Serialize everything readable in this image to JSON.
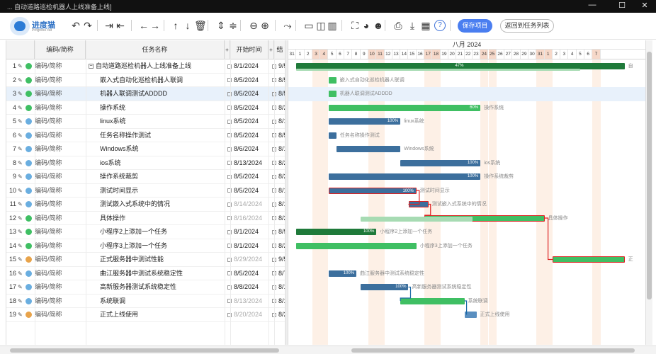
{
  "window": {
    "title": "... 自动道路巡检机器人上线准备上线]",
    "minimize": "—",
    "maximize": "☐",
    "close": "✕"
  },
  "logo": {
    "name": "进度猫",
    "sub": "Progress cat"
  },
  "toolbar": {
    "icons": [
      "undo-icon",
      "redo-icon",
      "indent-icon",
      "outdent-icon",
      "move-left-icon",
      "move-right-icon",
      "move-up-icon",
      "move-down-icon",
      "delete-icon",
      "expand-icon",
      "collapse-icon",
      "zoom-out-icon",
      "zoom-in-icon",
      "link-icon",
      "layout-1-icon",
      "layout-2-icon",
      "layout-3-icon",
      "fullscreen-icon",
      "palette-icon",
      "users-icon",
      "print-icon",
      "download-icon",
      "excel-icon",
      "help-icon"
    ],
    "save_label": "保存项目",
    "back_label": "返回到任务列表"
  },
  "grid": {
    "headers": {
      "code": "编码/简称",
      "name": "任务名称",
      "start": "开始时间",
      "end": "结"
    },
    "rows": [
      {
        "num": "1",
        "code": "编码/简称",
        "name": "自动道路巡检机器人上线准备上线",
        "start": "8/1/2024",
        "end": "9/5/",
        "dot": "#3fbf63",
        "fold": "−",
        "indent": 0,
        "dim": false
      },
      {
        "num": "2",
        "code": "编码/简称",
        "name": "嵌入式自动化巡检机器人联调",
        "start": "8/5/2024",
        "end": "8/5/",
        "dot": "#3fbf63",
        "fold": "",
        "indent": 1,
        "dim": false
      },
      {
        "num": "3",
        "code": "编码/简称",
        "name": "机器人联调测试ADDDD",
        "start": "8/5/2024",
        "end": "8/5/",
        "dot": "#3fbf63",
        "fold": "",
        "indent": 1,
        "dim": false
      },
      {
        "num": "4",
        "code": "编码/简称",
        "name": "操作系统",
        "start": "8/5/2024",
        "end": "8/20",
        "dot": "#3fbf63",
        "fold": "",
        "indent": 1,
        "dim": false
      },
      {
        "num": "5",
        "code": "编码/简称",
        "name": "linux系统",
        "start": "8/5/2024",
        "end": "8/12",
        "dot": "#6aaee0",
        "fold": "",
        "indent": 1,
        "dim": false
      },
      {
        "num": "6",
        "code": "编码/简称",
        "name": "任务名称操作测试",
        "start": "8/5/2024",
        "end": "8/5/",
        "dot": "#6aaee0",
        "fold": "",
        "indent": 1,
        "dim": false
      },
      {
        "num": "7",
        "code": "编码/简称",
        "name": "Windows系统",
        "start": "8/6/2024",
        "end": "8/12",
        "dot": "#6aaee0",
        "fold": "",
        "indent": 1,
        "dim": false
      },
      {
        "num": "8",
        "code": "编码/简称",
        "name": "ios系统",
        "start": "8/13/2024",
        "end": "8/20",
        "dot": "#6aaee0",
        "fold": "",
        "indent": 1,
        "dim": false
      },
      {
        "num": "9",
        "code": "编码/简称",
        "name": "操作系统裁剪",
        "start": "8/5/2024",
        "end": "8/20",
        "dot": "#6aaee0",
        "fold": "",
        "indent": 1,
        "dim": false
      },
      {
        "num": "10",
        "code": "编码/简称",
        "name": "测试时间显示",
        "start": "8/5/2024",
        "end": "8/12",
        "dot": "#6aaee0",
        "fold": "",
        "indent": 1,
        "dim": false
      },
      {
        "num": "11",
        "code": "编码/简称",
        "name": "测试嵌入式系统中的情况",
        "start": "8/14/2024",
        "end": "8/15",
        "dot": "#6aaee0",
        "fold": "",
        "indent": 1,
        "dim": true
      },
      {
        "num": "12",
        "code": "编码/简称",
        "name": "具体操作",
        "start": "8/16/2024",
        "end": "8/28",
        "dot": "#3fbf63",
        "fold": "",
        "indent": 1,
        "dim": true
      },
      {
        "num": "13",
        "code": "编码/简称",
        "name": "小程序2上添加一个任务",
        "start": "8/1/2024",
        "end": "8/9/",
        "dot": "#3fbf63",
        "fold": "",
        "indent": 1,
        "dim": false
      },
      {
        "num": "14",
        "code": "编码/简称",
        "name": "小程序3上添加一个任务",
        "start": "8/1/2024",
        "end": "8/20",
        "dot": "#3fbf63",
        "fold": "",
        "indent": 1,
        "dim": false
      },
      {
        "num": "15",
        "code": "编码/简称",
        "name": "正式服务器中测试性能",
        "start": "8/29/2024",
        "end": "9/5/",
        "dot": "#e8a34a",
        "fold": "",
        "indent": 1,
        "dim": true
      },
      {
        "num": "16",
        "code": "编码/简称",
        "name": "曲江服务器中测试系统稳定性",
        "start": "8/5/2024",
        "end": "8/7/",
        "dot": "#6aaee0",
        "fold": "",
        "indent": 1,
        "dim": false
      },
      {
        "num": "17",
        "code": "编码/简称",
        "name": "高新服务器测试系统稳定性",
        "start": "8/8/2024",
        "end": "8/12",
        "dot": "#6aaee0",
        "fold": "",
        "indent": 1,
        "dim": false
      },
      {
        "num": "18",
        "code": "编码/简称",
        "name": "系统联调",
        "start": "8/13/2024",
        "end": "8/19",
        "dot": "#6aaee0",
        "fold": "",
        "indent": 1,
        "dim": true
      },
      {
        "num": "19",
        "code": "编码/简称",
        "name": "正式上线使用",
        "start": "8/20/2024",
        "end": "8/20",
        "dot": "#e8a34a",
        "fold": "",
        "indent": 1,
        "dim": true
      }
    ]
  },
  "gantt": {
    "month": "八月 2024",
    "days": [
      "31",
      "1",
      "2",
      "3",
      "4",
      "5",
      "6",
      "7",
      "8",
      "9",
      "10",
      "11",
      "12",
      "13",
      "14",
      "15",
      "16",
      "17",
      "18",
      "19",
      "20",
      "21",
      "22",
      "23",
      "24",
      "25",
      "26",
      "27",
      "28",
      "29",
      "30",
      "31",
      "1",
      "2",
      "3",
      "4",
      "5",
      "6",
      "7"
    ],
    "weekend_idx": [
      3,
      4,
      10,
      11,
      17,
      18,
      24,
      25,
      31,
      32,
      38
    ],
    "today_idx": 5,
    "bars": [
      {
        "row": 0,
        "start": 1,
        "len": 41,
        "style": "dgreen",
        "pct": "47%",
        "label": "自",
        "critical": false
      },
      {
        "row": 0,
        "start": 1,
        "len": 35.5,
        "style": "pale",
        "pct": "",
        "label": "",
        "critical": false,
        "overlay": true
      },
      {
        "row": 1,
        "start": 5,
        "len": 1,
        "style": "green",
        "pct": "",
        "label": "嵌入式自动化巡检机器人联调",
        "critical": false
      },
      {
        "row": 2,
        "start": 5,
        "len": 1,
        "style": "green",
        "pct": "",
        "label": "机器人联调测试ADDDD",
        "critical": false
      },
      {
        "row": 3,
        "start": 5,
        "len": 19,
        "style": "green",
        "pct": "60%",
        "label": "操作系统",
        "critical": false
      },
      {
        "row": 4,
        "start": 5,
        "len": 9,
        "style": "blue",
        "pct": "100%",
        "label": "linux系统",
        "critical": false
      },
      {
        "row": 5,
        "start": 5,
        "len": 1,
        "style": "blue",
        "pct": "",
        "label": "任务名称操作测试",
        "critical": false
      },
      {
        "row": 6,
        "start": 6,
        "len": 8,
        "style": "blue",
        "pct": "",
        "label": "Windows系统",
        "critical": false
      },
      {
        "row": 7,
        "start": 14,
        "len": 10,
        "style": "blue",
        "pct": "100%",
        "label": "ios系统",
        "critical": false
      },
      {
        "row": 8,
        "start": 5,
        "len": 19,
        "style": "blue",
        "pct": "100%",
        "label": "操作系统裁剪",
        "critical": false
      },
      {
        "row": 9,
        "start": 5,
        "len": 11,
        "style": "blue",
        "pct": "100%",
        "label": "测试时间显示",
        "critical": true
      },
      {
        "row": 10,
        "start": 15,
        "len": 2.5,
        "style": "blue",
        "pct": "",
        "label": "测试嵌入式系统中的情况",
        "critical": true
      },
      {
        "row": 11,
        "start": 17,
        "len": 15,
        "style": "green",
        "pct": "",
        "label": "具体操作",
        "critical": true
      },
      {
        "row": 11,
        "start": 9,
        "len": 14,
        "style": "pale",
        "pct": "",
        "label": "",
        "critical": false
      },
      {
        "row": 12,
        "start": 1,
        "len": 10,
        "style": "dgreen",
        "pct": "100%",
        "label": "小程序2上添加一个任务",
        "critical": false
      },
      {
        "row": 13,
        "start": 1,
        "len": 15,
        "style": "green",
        "pct": "",
        "label": "小程序3上添加一个任务",
        "critical": false
      },
      {
        "row": 14,
        "start": 33,
        "len": 9,
        "style": "green",
        "pct": "",
        "label": "正",
        "critical": true
      },
      {
        "row": 15,
        "start": 5,
        "len": 3.5,
        "style": "blue",
        "pct": "100%",
        "label": "曲江服务器中测试系统稳定性",
        "critical": false
      },
      {
        "row": 16,
        "start": 9,
        "len": 6,
        "style": "blue",
        "pct": "100%",
        "label": "高新服务器测试系统稳定性",
        "critical": false
      },
      {
        "row": 17,
        "start": 14,
        "len": 8,
        "style": "green",
        "pct": "",
        "label": "系统联调",
        "critical": false
      },
      {
        "row": 18,
        "start": 22,
        "len": 1.5,
        "style": "lblue",
        "pct": "",
        "label": "正式上线使用",
        "critical": false
      }
    ]
  }
}
